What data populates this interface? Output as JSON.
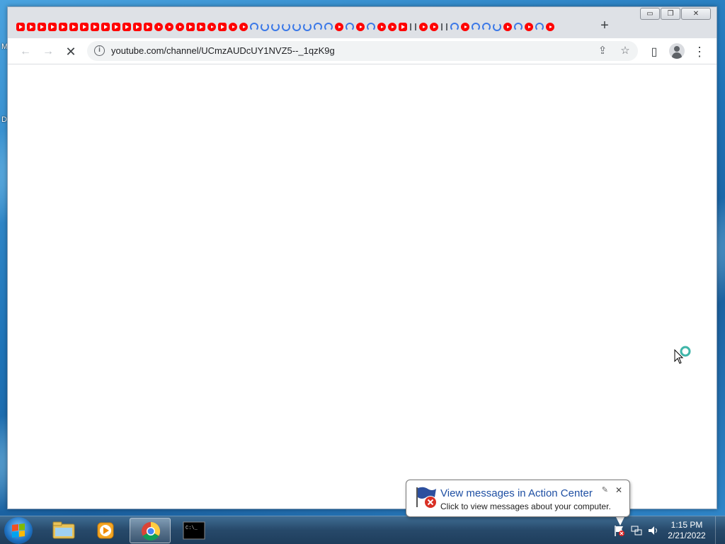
{
  "desktop": {
    "edge_letters": [
      "M",
      "D"
    ]
  },
  "browser": {
    "tab_favicons": [
      "yt",
      "yt",
      "yt",
      "yt",
      "yt",
      "yt",
      "yt",
      "yt",
      "yt",
      "yt",
      "yt",
      "yt",
      "yt",
      "ytc",
      "ytc",
      "ytc",
      "yt",
      "yt",
      "ytc",
      "yt",
      "ytc",
      "ytc",
      "spin",
      "spin2",
      "spin2",
      "spin2",
      "spin2",
      "spin2",
      "spin",
      "spin",
      "ytc",
      "spin",
      "ytc",
      "spin",
      "ytc",
      "ytc",
      "yt",
      "dot",
      "dot",
      "ytc",
      "ytc",
      "dot",
      "dot",
      "spin",
      "ytc",
      "spin",
      "spin",
      "spin2",
      "ytc",
      "spin",
      "ytc",
      "spin",
      "ytc"
    ],
    "new_tab_label": "+",
    "window_controls": {
      "minimize": "▭",
      "restore": "❐",
      "close": "✕"
    },
    "nav": {
      "back": "←",
      "forward": "→",
      "stop": "✕"
    },
    "omnibox": {
      "url": "youtube.com/channel/UCmzAUDcUY1NVZ5--_1qzK9g",
      "info_icon": "i"
    },
    "omnibox_actions": {
      "share": "⇪",
      "bookmark": "☆"
    },
    "menu_icon": "⋮",
    "side_panel_icon": "▯"
  },
  "notification": {
    "title": "View messages in Action Center",
    "text": "Click to view messages about your computer.",
    "close": "✕",
    "pin": "✎"
  },
  "taskbar": {
    "time": "1:15 PM",
    "date": "2/21/2022",
    "apps": [
      "explorer",
      "media-player",
      "chrome",
      "cmd"
    ],
    "cmd_prompt": "C:\\_"
  },
  "colors": {
    "accent_blue": "#1e4fa3",
    "youtube_red": "#ff0000",
    "tab_bar": "#dee1e6",
    "omnibox": "#f1f3f4"
  }
}
